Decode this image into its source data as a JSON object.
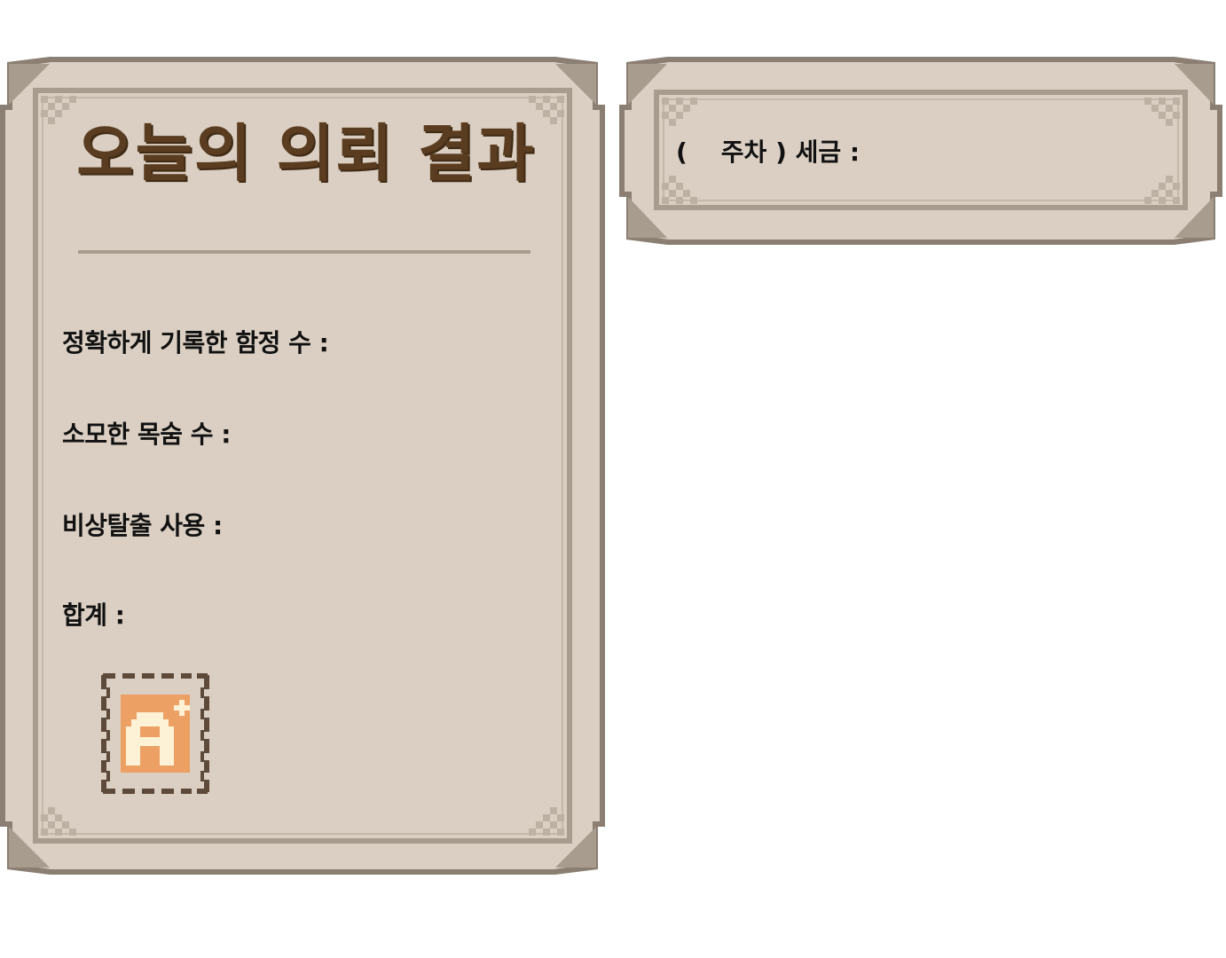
{
  "result_panel": {
    "title": "오늘의 의뢰 결과",
    "stats": [
      {
        "label": "정확하게 기록한 함정 수 :"
      },
      {
        "label": "소모한 목숨 수 :"
      },
      {
        "label": "비상탈출 사용 :"
      },
      {
        "label": "합계 :"
      }
    ],
    "grade": {
      "icon": "grade-stamp-icon",
      "letter": "A",
      "modifier": "+"
    }
  },
  "tax_panel": {
    "open_paren": "(",
    "week_label": "주차 )",
    "tax_label": "세금 :"
  },
  "colors": {
    "panel_fill": "#dacfc2",
    "panel_border": "#8a7f72",
    "panel_inner_line": "#a89c8e",
    "title_text": "#5a3c20",
    "stamp_border": "#5e4a3a",
    "stamp_fill": "#eda063",
    "stamp_letter": "#fdf2d6"
  }
}
